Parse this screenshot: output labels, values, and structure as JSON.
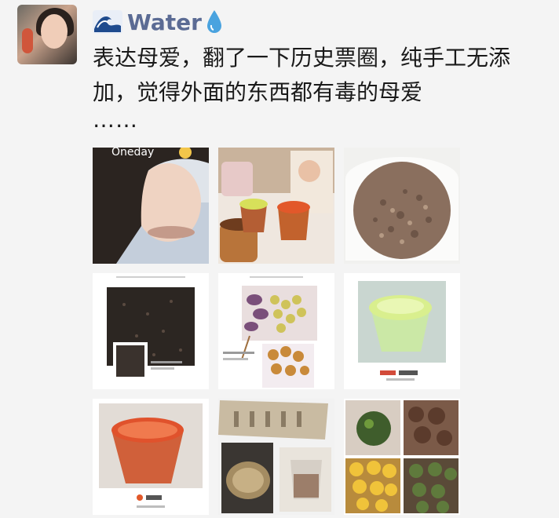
{
  "post": {
    "username": "Water",
    "text": "表达母爱，翻了一下历史票圈，纯手工无添加，觉得外面的东西都有毒的母爱",
    "ellipsis": "……",
    "photo_overlay_label": "Oneday",
    "photos": [
      {
        "name": "photo-selfie"
      },
      {
        "name": "photo-baby-food-jars"
      },
      {
        "name": "photo-meat-floss-bowl"
      },
      {
        "name": "photo-black-sesame-powder"
      },
      {
        "name": "photo-baked-snacks"
      },
      {
        "name": "photo-green-cup"
      },
      {
        "name": "photo-orange-cup-puree"
      },
      {
        "name": "photo-cooking-collage"
      },
      {
        "name": "photo-dumplings-collage"
      }
    ]
  },
  "colors": {
    "username": "#5b6b94",
    "text": "#1a1a1a",
    "background": "#f4f4f4"
  }
}
